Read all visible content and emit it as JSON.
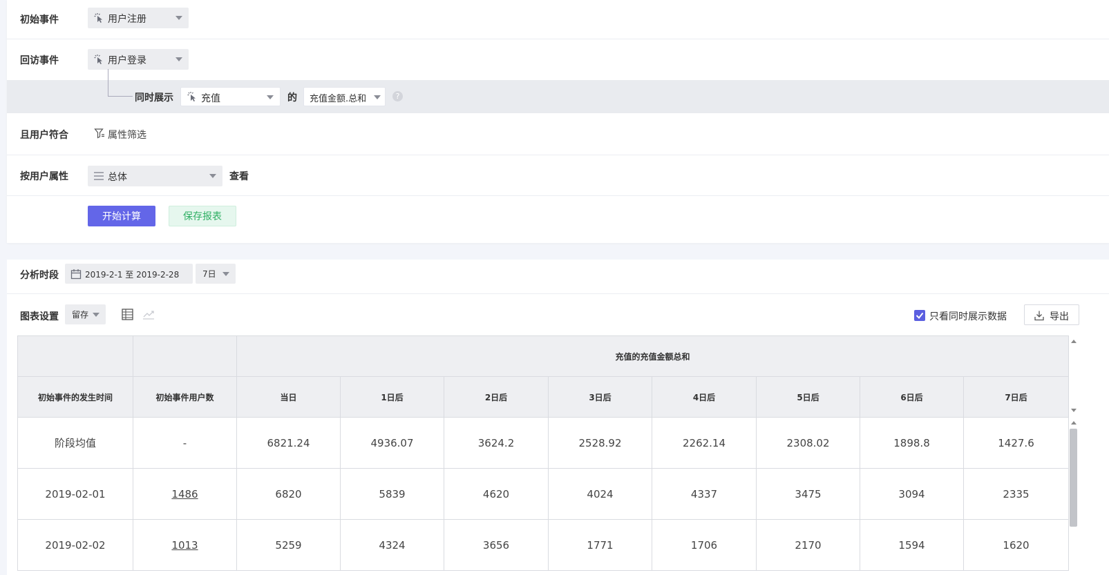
{
  "query": {
    "initial_event": {
      "label": "初始事件",
      "value": "用户注册"
    },
    "return_event": {
      "label": "回访事件",
      "value": "用户登录"
    },
    "also_show": {
      "label": "同时展示",
      "event": "充值",
      "of": "的",
      "metric": "充值金额.总和"
    },
    "user_filter": {
      "label": "且用户符合",
      "action": "属性筛选"
    },
    "group_by": {
      "label": "按用户属性",
      "value": "总体",
      "suffix": "查看"
    },
    "buttons": {
      "calculate": "开始计算",
      "save": "保存报表"
    }
  },
  "result": {
    "period": {
      "label": "分析时段",
      "range": "2019-2-1 至 2019-2-28",
      "interval": "7日"
    },
    "chart_settings": {
      "label": "图表设置",
      "mode": "留存"
    },
    "only_show_label": "只看同时展示数据",
    "export_label": "导出",
    "table": {
      "group_header": "充值的充值金额总和",
      "columns": [
        "初始事件的发生时间",
        "初始事件用户数",
        "当日",
        "1日后",
        "2日后",
        "3日后",
        "4日后",
        "5日后",
        "6日后",
        "7日后"
      ],
      "rows": [
        {
          "date": "阶段均值",
          "users": "-",
          "values": [
            "6821.24",
            "4936.07",
            "3624.2",
            "2528.92",
            "2262.14",
            "2308.02",
            "1898.8",
            "1427.6"
          ]
        },
        {
          "date": "2019-02-01",
          "users": "1486",
          "values": [
            "6820",
            "5839",
            "4620",
            "4024",
            "4337",
            "3475",
            "3094",
            "2335"
          ]
        },
        {
          "date": "2019-02-02",
          "users": "1013",
          "values": [
            "5259",
            "4324",
            "3656",
            "1771",
            "1706",
            "2170",
            "1594",
            "1620"
          ]
        }
      ]
    }
  }
}
